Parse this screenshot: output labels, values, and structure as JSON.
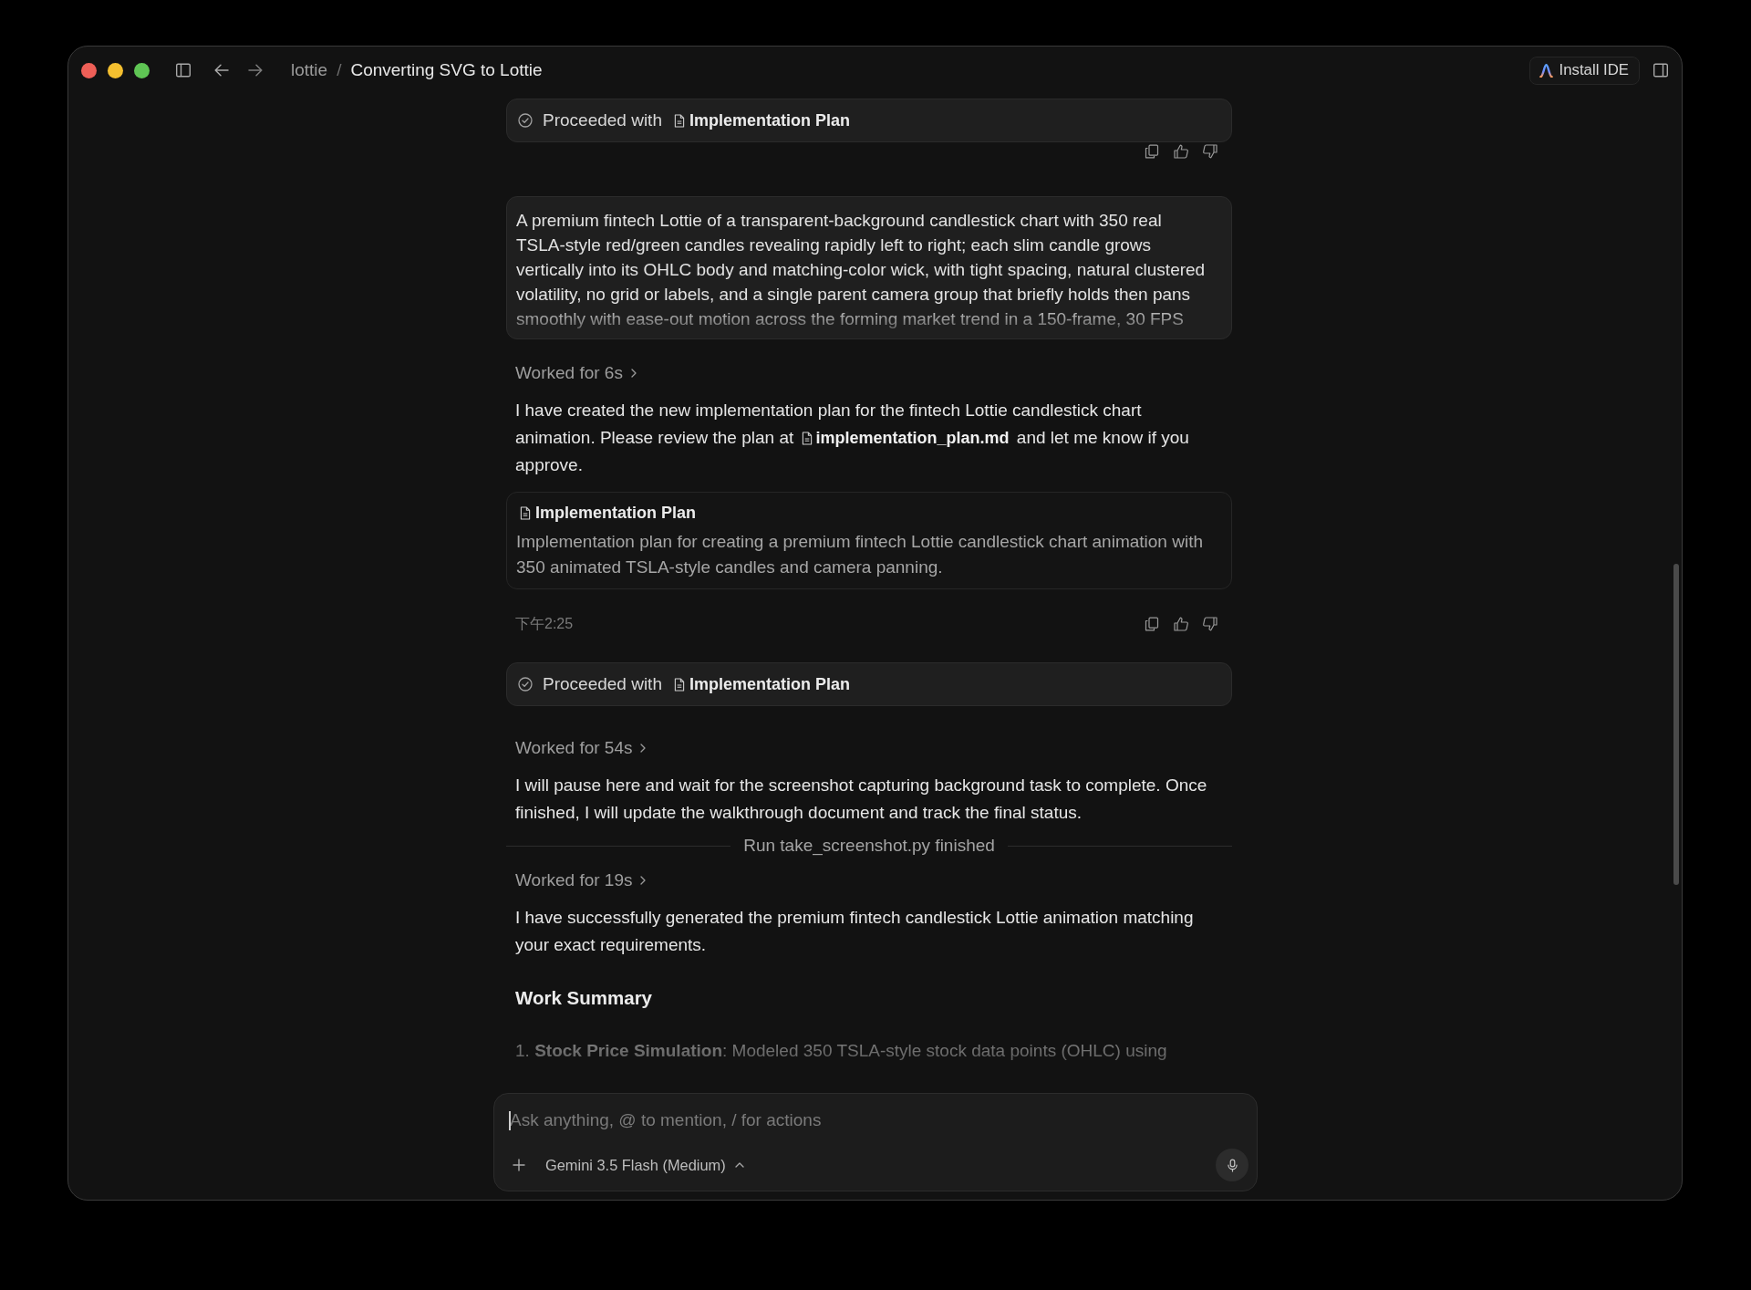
{
  "window": {
    "breadcrumb": {
      "separator": "/",
      "items": [
        {
          "label": "lottie",
          "selected": false
        },
        {
          "label": "Converting SVG to Lottie",
          "selected": true
        }
      ]
    },
    "install_button": "Install IDE"
  },
  "conversation": [
    {
      "kind": "proceeded",
      "label": "Proceeded with",
      "file": "Implementation Plan"
    },
    {
      "kind": "feedback"
    },
    {
      "kind": "prompt",
      "text": "A premium fintech Lottie of a transparent-background candlestick chart with 350 real TSLA-style red/green candles revealing rapidly left to right; each slim candle grows vertically into its OHLC body and matching-color wick, with tight spacing, natural clustered volatility, no grid or labels, and a single parent camera group that briefly holds then pans smoothly with ease-out motion across the forming market trend in a 150-frame, 30 FPS"
    },
    {
      "kind": "worked",
      "text": "Worked for 6s"
    },
    {
      "kind": "reply",
      "text": "I have created the new implementation plan for the fintech Lottie candlestick chart animation. Please review the plan at",
      "file": "implementation_plan.md",
      "text_after": "and let me know if you approve."
    },
    {
      "kind": "artifact",
      "title": "Implementation Plan",
      "description": "Implementation plan for creating a premium fintech Lottie candlestick chart animation with 350 animated TSLA-style candles and camera panning."
    },
    {
      "kind": "feedback",
      "time": "下午2:25"
    },
    {
      "kind": "proceeded",
      "label": "Proceeded with",
      "file": "Implementation Plan"
    },
    {
      "kind": "worked",
      "text": "Worked for 54s"
    },
    {
      "kind": "reply",
      "text": "I will pause here and wait for the screenshot capturing background task to complete. Once finished, I will update the walkthrough document and track the final status."
    },
    {
      "kind": "divider",
      "text": "Run take_screenshot.py finished"
    },
    {
      "kind": "worked",
      "text": "Worked for 19s"
    },
    {
      "kind": "reply",
      "text": "I have successfully generated the premium fintech candlestick Lottie animation matching your exact requirements."
    },
    {
      "kind": "heading",
      "text": "Work Summary"
    },
    {
      "kind": "list_item",
      "marker": "1.",
      "text": "**Stock Price Simulation**: Modeled 350 TSLA-style stock data points (OHLC) using"
    }
  ],
  "composer": {
    "placeholder": "Ask anything, @ to mention, / for actions",
    "model": "Gemini 3.5 Flash (Medium)"
  }
}
